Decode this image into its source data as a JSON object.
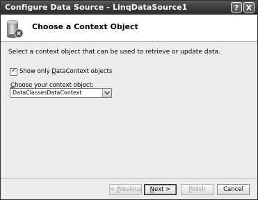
{
  "window": {
    "title": "Configure Data Source - LinqDataSource1",
    "help_glyph": "?",
    "close_glyph": "X"
  },
  "header": {
    "icon": "database-icon",
    "title": "Choose a Context Object"
  },
  "body": {
    "description": "Select a context object that can be used to retrieve or update data.",
    "checkbox": {
      "checked": true,
      "label_prefix": "Show only ",
      "label_underlined": "D",
      "label_rest": "ataContext objects"
    },
    "context_label_underlined": "C",
    "context_label_rest": "hoose your context object:",
    "context_select": {
      "value": "DataClassesDataContext"
    }
  },
  "buttons": {
    "previous_prefix": "< ",
    "previous_underlined": "P",
    "previous_rest": "revious",
    "next_underlined": "N",
    "next_rest": "ext >",
    "finish_underlined": "F",
    "finish_rest": "inish",
    "cancel": "Cancel"
  }
}
